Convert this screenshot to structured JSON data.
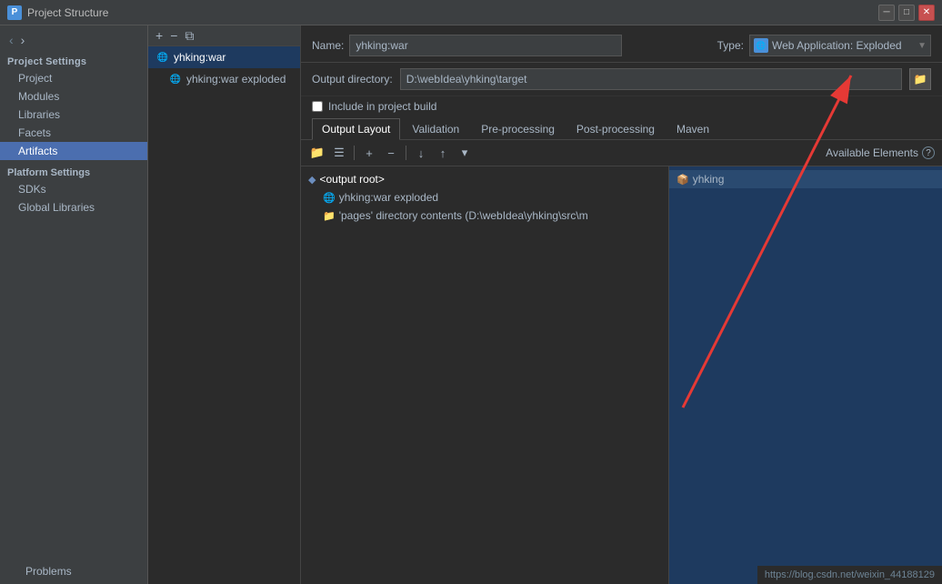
{
  "titleBar": {
    "icon": "PS",
    "title": "Project Structure",
    "closeLabel": "✕",
    "minLabel": "─",
    "maxLabel": "□"
  },
  "sidebar": {
    "navBack": "‹",
    "navForward": "›",
    "projectSettingsHeader": "Project Settings",
    "projectSettingsItems": [
      {
        "id": "project",
        "label": "Project"
      },
      {
        "id": "modules",
        "label": "Modules"
      },
      {
        "id": "libraries",
        "label": "Libraries"
      },
      {
        "id": "facets",
        "label": "Facets"
      },
      {
        "id": "artifacts",
        "label": "Artifacts",
        "active": true
      }
    ],
    "platformSettingsHeader": "Platform Settings",
    "platformItems": [
      {
        "id": "sdks",
        "label": "SDKs"
      },
      {
        "id": "global-libraries",
        "label": "Global Libraries"
      }
    ],
    "problemsLabel": "Problems"
  },
  "artifactList": {
    "toolbarAdd": "+",
    "toolbarRemove": "−",
    "toolbarCopy": "⧉",
    "items": [
      {
        "id": "yhking-war",
        "label": "yhking:war",
        "active": true
      },
      {
        "id": "yhking-war-exploded",
        "label": "yhking:war exploded",
        "sub": true
      }
    ]
  },
  "mainContent": {
    "nameLabel": "Name:",
    "nameValue": "yhking:war",
    "typeLabel": "Type:",
    "typeValue": "Web Application: Exploded",
    "outputDirLabel": "Output directory:",
    "outputDirValue": "D:\\webIdea\\yhking\\target",
    "includeBuildLabel": "Include in project build",
    "tabs": [
      {
        "id": "output-layout",
        "label": "Output Layout",
        "active": true
      },
      {
        "id": "validation",
        "label": "Validation"
      },
      {
        "id": "pre-processing",
        "label": "Pre-processing"
      },
      {
        "id": "post-processing",
        "label": "Post-processing"
      },
      {
        "id": "maven",
        "label": "Maven"
      }
    ],
    "innerToolbar": {
      "dirIcon": "📁",
      "addIcon": "+",
      "removeIcon": "−",
      "downIcon": "↓",
      "upIcon": "↑",
      "moreIcon": "▾"
    },
    "availableElementsLabel": "Available Elements",
    "helpIcon": "?",
    "outputTreeItems": [
      {
        "id": "output-root",
        "label": "<output root>",
        "level": 0,
        "type": "root"
      },
      {
        "id": "yhking-war-exploded",
        "label": "yhking:war exploded",
        "level": 1,
        "type": "war"
      },
      {
        "id": "pages-dir",
        "label": "'pages' directory contents (D:\\webIdea\\yhking\\src\\m",
        "level": 1,
        "type": "folder"
      }
    ],
    "availableItems": [
      {
        "id": "yhking",
        "label": "yhking",
        "type": "module"
      }
    ]
  },
  "urlBar": {
    "text": "https://blog.csdn.net/weixin_44188129"
  }
}
